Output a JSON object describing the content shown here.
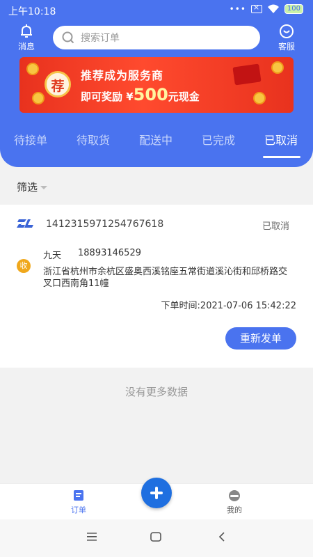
{
  "status_bar": {
    "time": "上午10:18",
    "dots": "•••",
    "battery": "100"
  },
  "header": {
    "message_label": "消息",
    "service_label": "客服",
    "search_placeholder": "搜索订单"
  },
  "banner": {
    "badge": "荐",
    "line1": "推荐成为服务商",
    "line2_prefix": "即可奖励 ¥",
    "line2_amount": "500",
    "line2_suffix": "元现金"
  },
  "tabs": [
    {
      "label": "待接单",
      "active": false
    },
    {
      "label": "待取货",
      "active": false
    },
    {
      "label": "配送中",
      "active": false
    },
    {
      "label": "已完成",
      "active": false
    },
    {
      "label": "已取消",
      "active": true
    }
  ],
  "filter": {
    "label": "筛选"
  },
  "order": {
    "number": "1412315971254767618",
    "status": "已取消",
    "receiver_badge": "收",
    "name": "九天",
    "phone": "18893146529",
    "address": "浙江省杭州市余杭区盛奥西溪铭座五常街道溪沁街和邱桥路交叉口西南角11幢",
    "time": "下单时间:2021-07-06 15:42:22",
    "reorder_label": "重新发单"
  },
  "empty_text": "没有更多数据",
  "bottom_nav": {
    "orders_label": "订单",
    "mine_label": "我的"
  },
  "colors": {
    "primary": "#4a73ef",
    "fab": "#1f6fe0",
    "receiver_badge": "#f0a81c"
  }
}
